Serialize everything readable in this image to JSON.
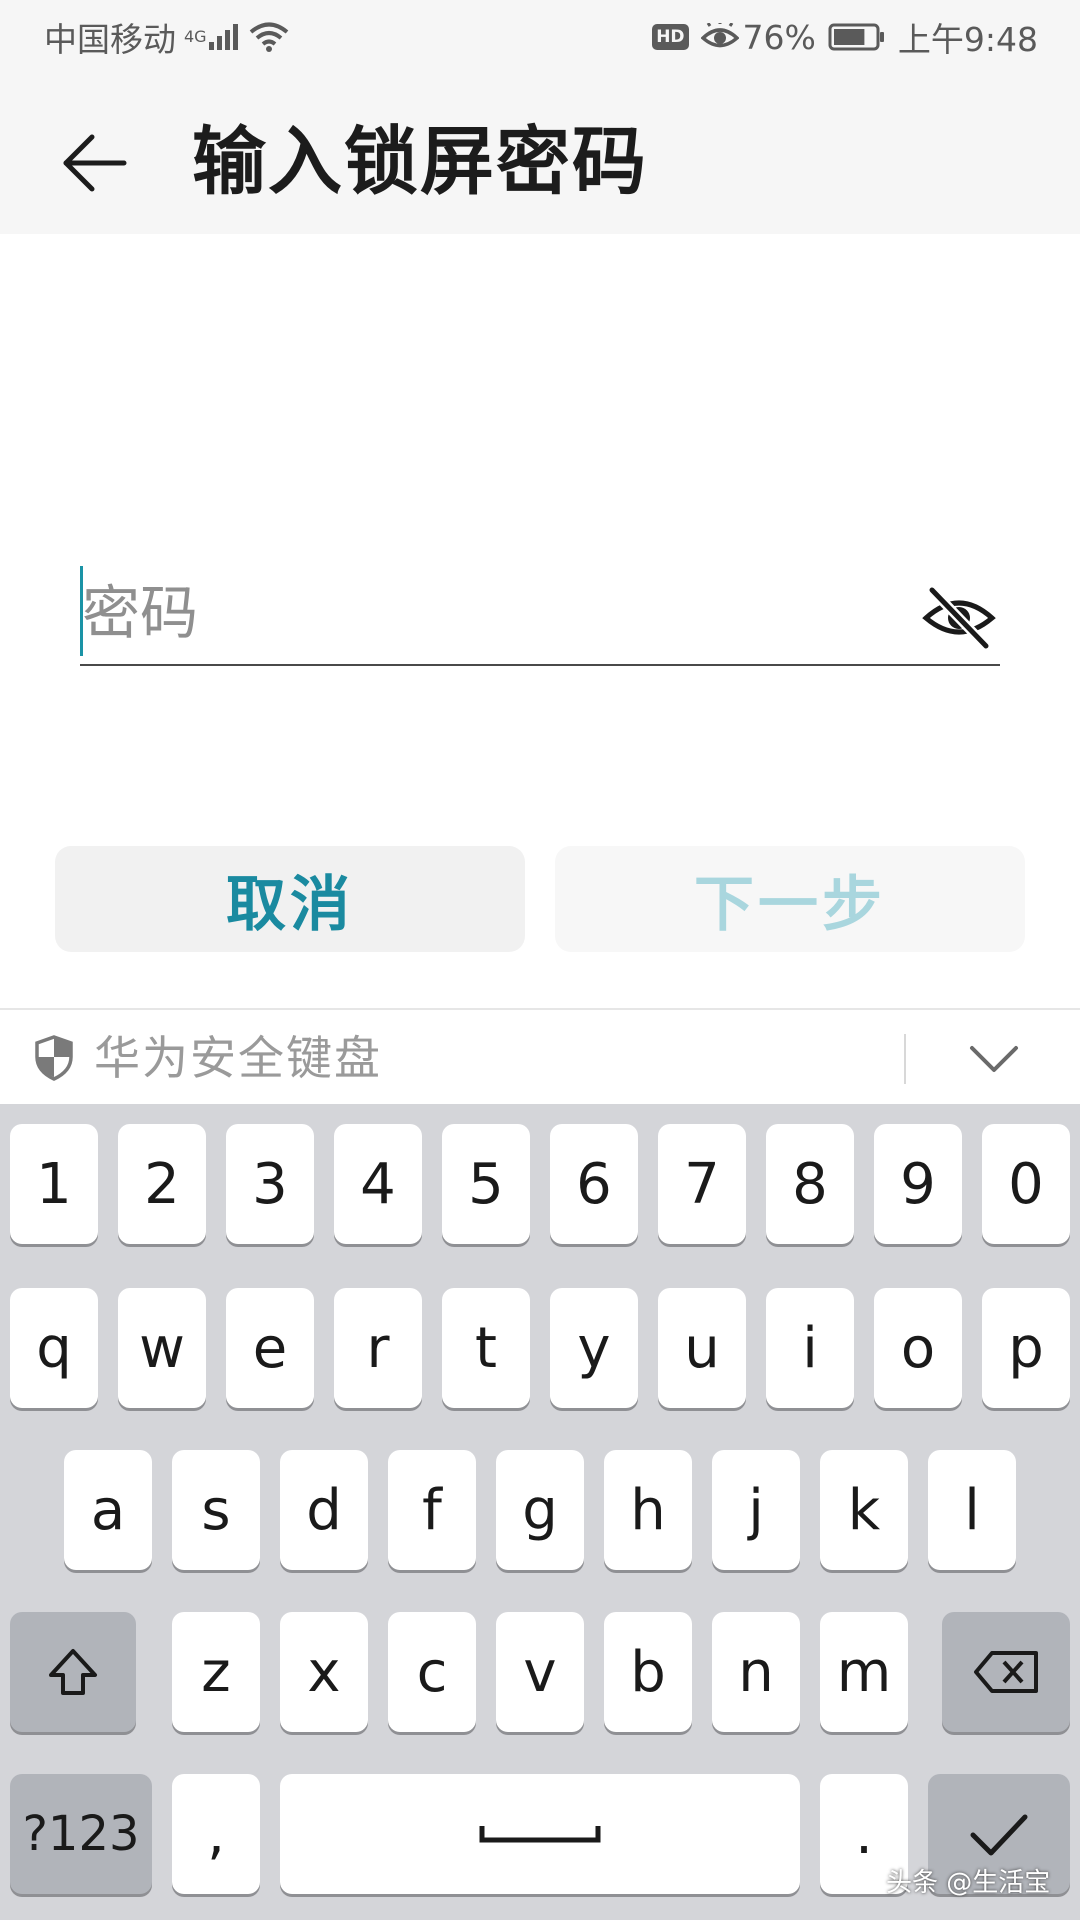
{
  "status_bar": {
    "carrier": "中国移动",
    "network": "4G",
    "hd_badge": "HD",
    "battery_percent": "76%",
    "battery_level": 0.76,
    "time": "上午9:48",
    "icons": [
      "signal-icon",
      "wifi-icon",
      "hd-icon",
      "eye-comfort-icon",
      "battery-icon"
    ]
  },
  "app_bar": {
    "back_icon": "arrow-left-icon",
    "title": "输入锁屏密码"
  },
  "password_field": {
    "placeholder": "密码",
    "value": "",
    "toggle_icon": "eye-off-icon"
  },
  "buttons": {
    "cancel": "取消",
    "next": "下一步"
  },
  "keyboard": {
    "header_icon": "shield-icon",
    "header_title": "华为安全键盘",
    "collapse_icon": "chevron-down-icon",
    "row_numbers": [
      "1",
      "2",
      "3",
      "4",
      "5",
      "6",
      "7",
      "8",
      "9",
      "0"
    ],
    "row_top": [
      "q",
      "w",
      "e",
      "r",
      "t",
      "y",
      "u",
      "i",
      "o",
      "p"
    ],
    "row_mid": [
      "a",
      "s",
      "d",
      "f",
      "g",
      "h",
      "j",
      "k",
      "l"
    ],
    "row_bottom": [
      "z",
      "x",
      "c",
      "v",
      "b",
      "n",
      "m"
    ],
    "shift_icon": "shift-icon",
    "backspace_icon": "backspace-icon",
    "symbols_label": "?123",
    "comma_label": ",",
    "space_icon": "space-icon",
    "period_label": ".",
    "enter_icon": "check-icon"
  },
  "watermark": "头条 @生活宝",
  "colors": {
    "accent": "#1a8aa0",
    "accent_disabled": "#a9d6de",
    "keyboard_bg": "#d4d5d9",
    "key_dark": "#b1b4ba"
  }
}
